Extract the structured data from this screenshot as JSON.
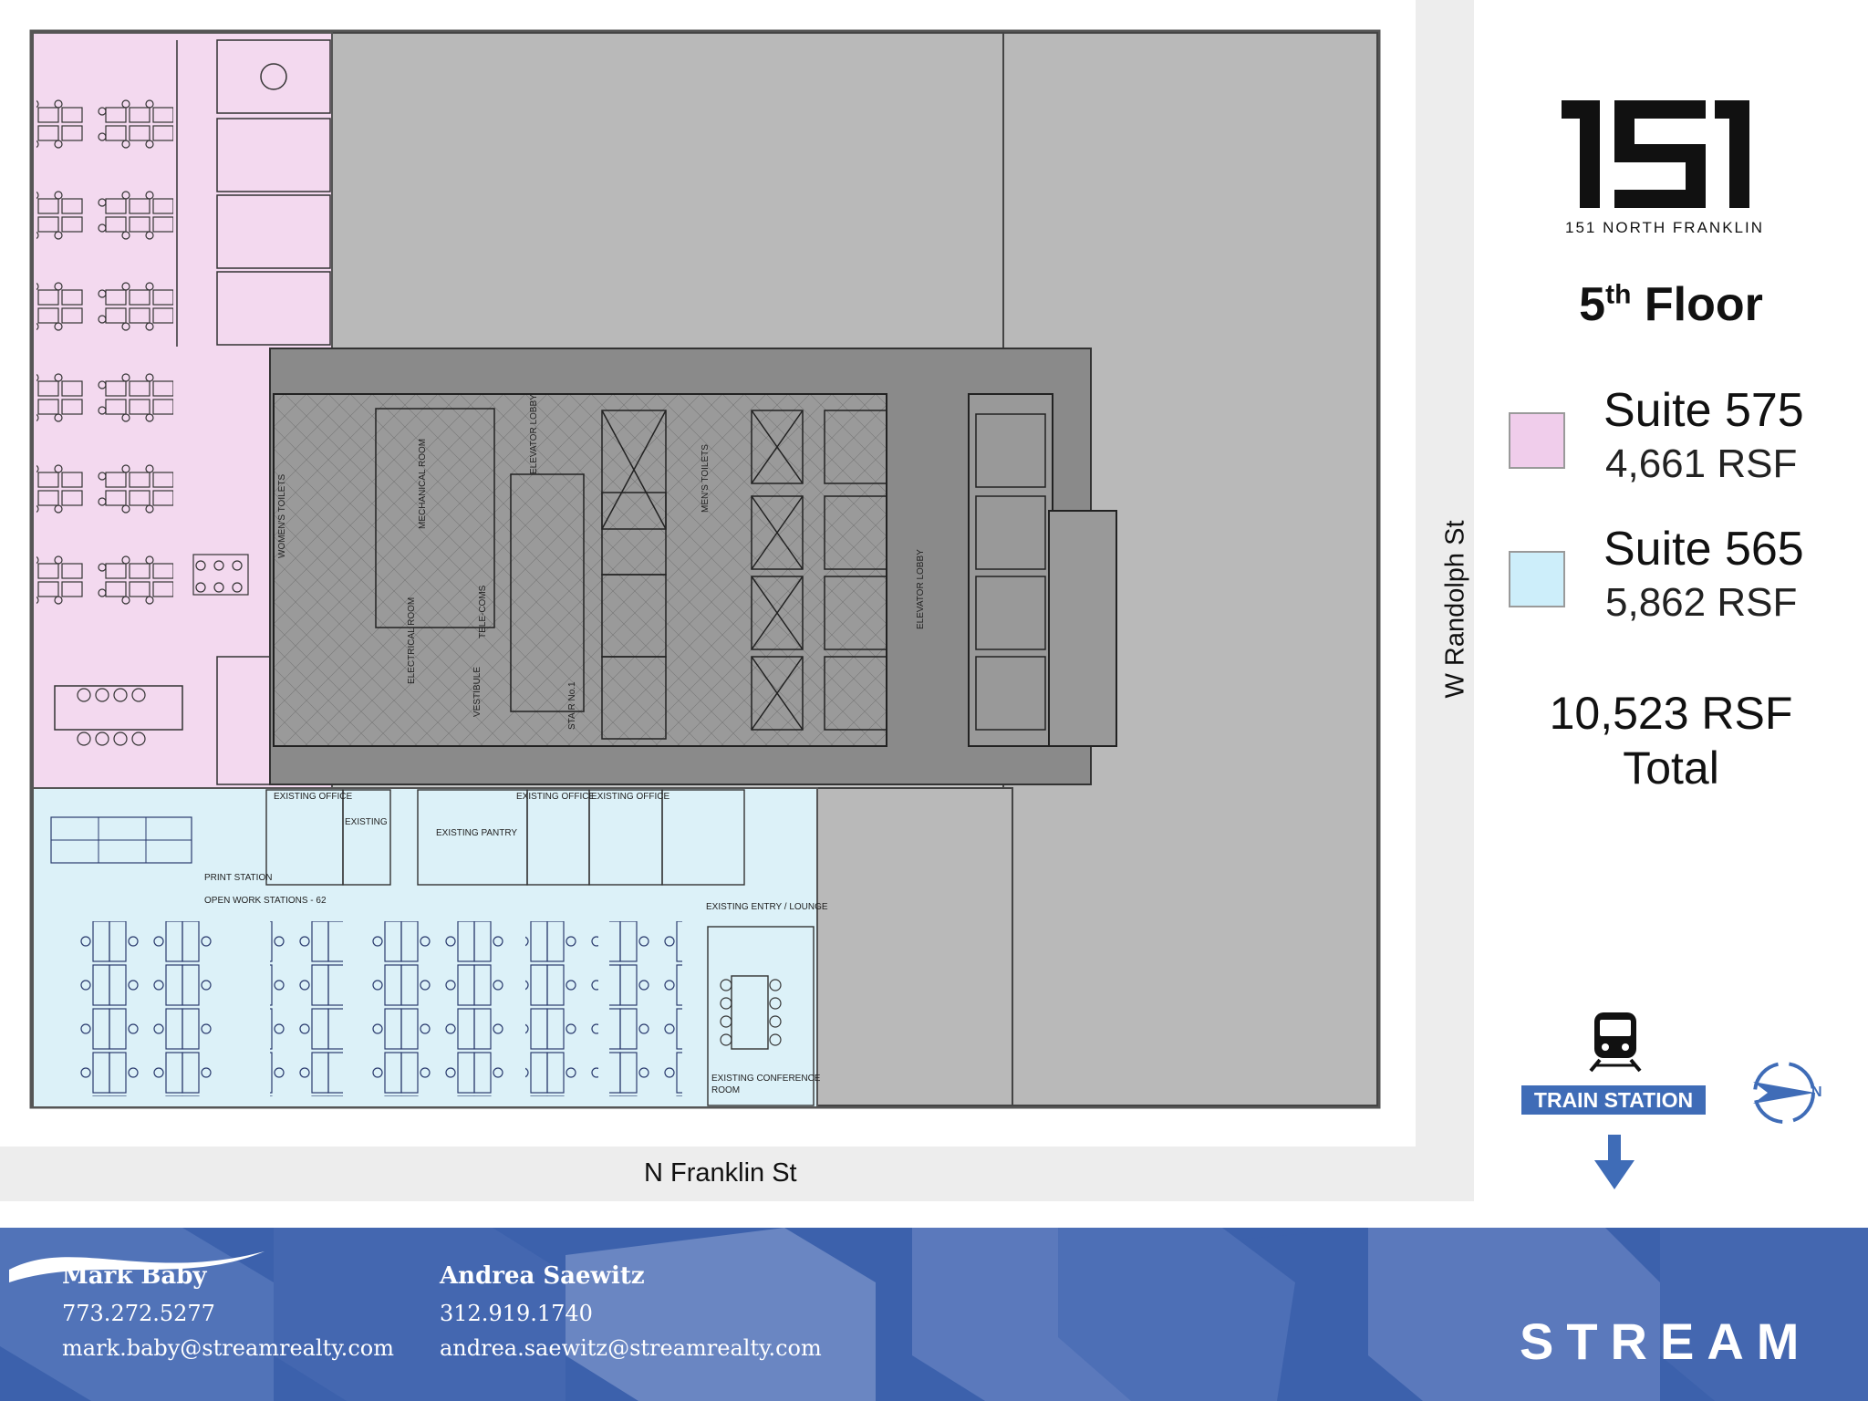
{
  "property": {
    "logo_number": "151",
    "name": "151 NORTH FRANKLIN",
    "floor_number": "5",
    "floor_suffix": "th",
    "floor_word": "Floor"
  },
  "suites": [
    {
      "name": "Suite 575",
      "rsf": "4,661 RSF",
      "color": "#f0cdeb"
    },
    {
      "name": "Suite 565",
      "rsf": "5,862 RSF",
      "color": "#cdeefa"
    }
  ],
  "total": {
    "value": "10,523 RSF",
    "label": "Total"
  },
  "streets": {
    "south": "N Franklin St",
    "east": "W Randolph St"
  },
  "plan_labels": {
    "existing_office": "EXISTING OFFICE",
    "existing": "EXISTING",
    "existing_pantry": "EXISTING PANTRY",
    "print_station": "PRINT STATION",
    "open_work": "OPEN WORK STATIONS - 62",
    "entry_lounge": "EXISTING ENTRY / LOUNGE",
    "conference_line1": "EXISTING CONFERENCE",
    "conference_line2": "ROOM",
    "elevator_lobby": "ELEVATOR LOBBY",
    "womens_toilets": "WOMEN'S TOILETS",
    "mens_toilets": "MEN'S TOILETS",
    "mechanical_room": "MECHANICAL ROOM",
    "electrical_room": "ELECTRICAL ROOM",
    "telecoms": "TELE-COMS",
    "vestibule": "VESTIBULE",
    "stair_no1": "STAIR No.1"
  },
  "transit": {
    "label": "TRAIN STATION",
    "icon": "train-icon",
    "arrow": "arrow-down-icon"
  },
  "compass": {
    "icon": "north-arrow-icon",
    "label": "N"
  },
  "contacts": [
    {
      "name": "Mark Bâby",
      "phone": "773.272.5277",
      "email": "mark.baby@streamrealty.com"
    },
    {
      "name": "Andrea Saewitz",
      "phone": "312.919.1740",
      "email": "andrea.saewitz@streamrealty.com"
    }
  ],
  "brand": {
    "name": "STREAM",
    "footer_color": "#3c61ac"
  }
}
